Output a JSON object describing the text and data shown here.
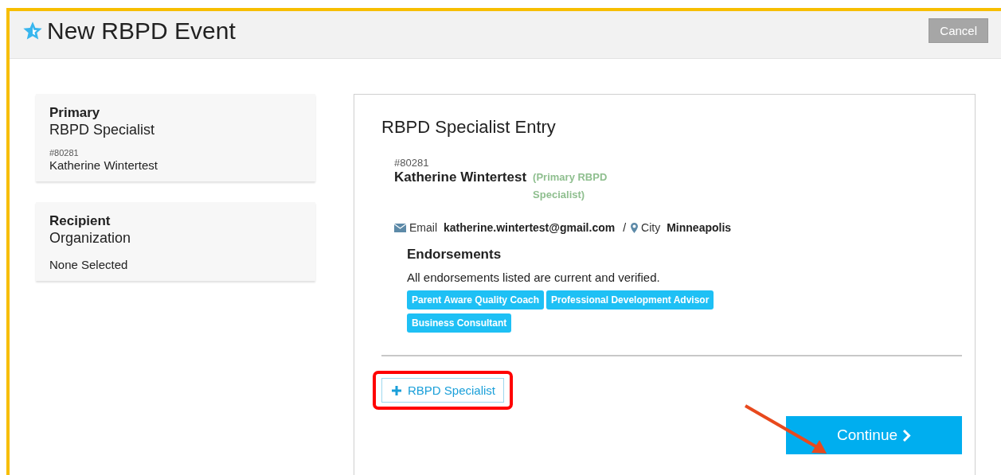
{
  "window": {
    "title": "New RBPD Event"
  },
  "cancel_button": "Cancel",
  "sidebar": [
    {
      "heading": "Primary",
      "subheading": "RBPD Specialist",
      "id": "#80281",
      "value": "Katherine Wintertest"
    },
    {
      "heading": "Recipient",
      "subheading": "Organization",
      "value": "None Selected"
    }
  ],
  "entry": {
    "title": "RBPD Specialist Entry",
    "id": "#80281",
    "name": "Katherine Wintertest",
    "role": "(Primary RBPD Specialist)",
    "email_label": "Email",
    "email": "katherine.wintertest@gmail.com",
    "separator": "/",
    "city_label": "City",
    "city": "Minneapolis",
    "endorsements": {
      "title": "Endorsements",
      "note": "All endorsements listed are current and verified.",
      "tags": [
        "Parent Aware Quality Coach",
        "Professional Development Advisor",
        "Business Consultant"
      ]
    }
  },
  "add_button": "RBPD Specialist",
  "continue_button": "Continue"
}
